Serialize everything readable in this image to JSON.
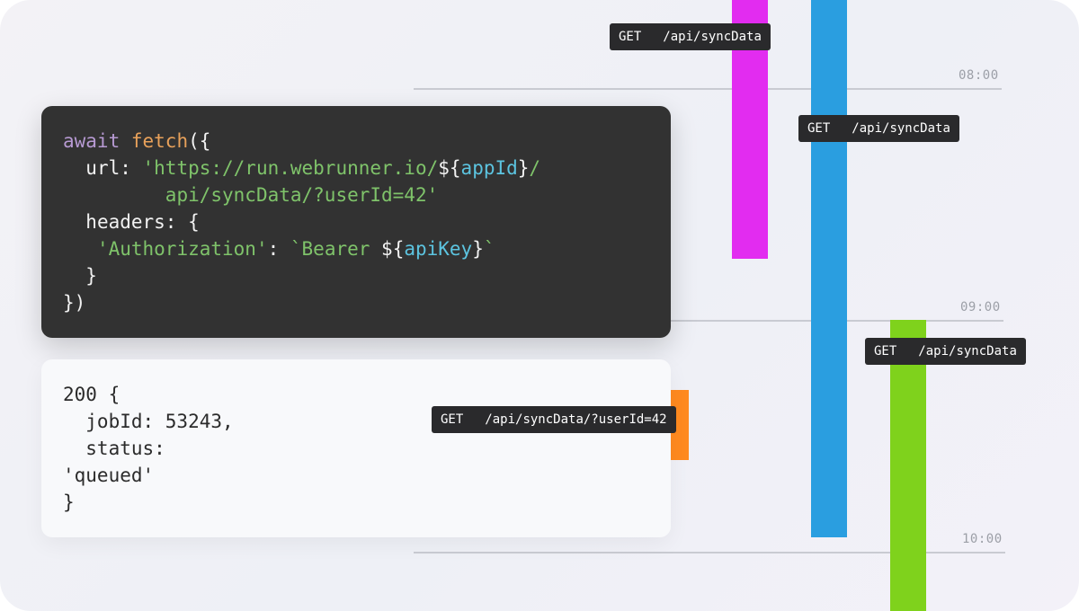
{
  "timeline": {
    "times": [
      "08:00",
      "09:00",
      "10:00"
    ],
    "colors": {
      "magenta": "#e22cf0",
      "blue": "#2a9ee0",
      "green": "#7fd21c",
      "orange": "#ff8a1f"
    },
    "requests": [
      {
        "method": "GET",
        "path": "/api/syncData"
      },
      {
        "method": "GET",
        "path": "/api/syncData"
      },
      {
        "method": "GET",
        "path": "/api/syncData"
      },
      {
        "method": "GET",
        "path": "/api/syncData/?userId=42"
      }
    ]
  },
  "code": {
    "kw_await": "await",
    "fn_fetch": "fetch",
    "open": "({",
    "url_key": "url: ",
    "url_str1": "'https://run.webrunner.io/",
    "interp_open": "${",
    "var_appId": "appId",
    "interp_close": "}",
    "url_str1_end": "/",
    "url_str2": "api/syncData/?userId=42'",
    "headers_key": "headers: {",
    "auth_key": "'Authorization'",
    "colon": ": ",
    "bearer_str": "`Bearer ",
    "var_apiKey": "apiKey",
    "backtick": "`",
    "close_brace": "}",
    "close_all": "})"
  },
  "response": {
    "line1": "200 {",
    "line2": "  jobId: 53243,",
    "line3": "  status:",
    "line4": "'queued'",
    "line5": "}"
  }
}
